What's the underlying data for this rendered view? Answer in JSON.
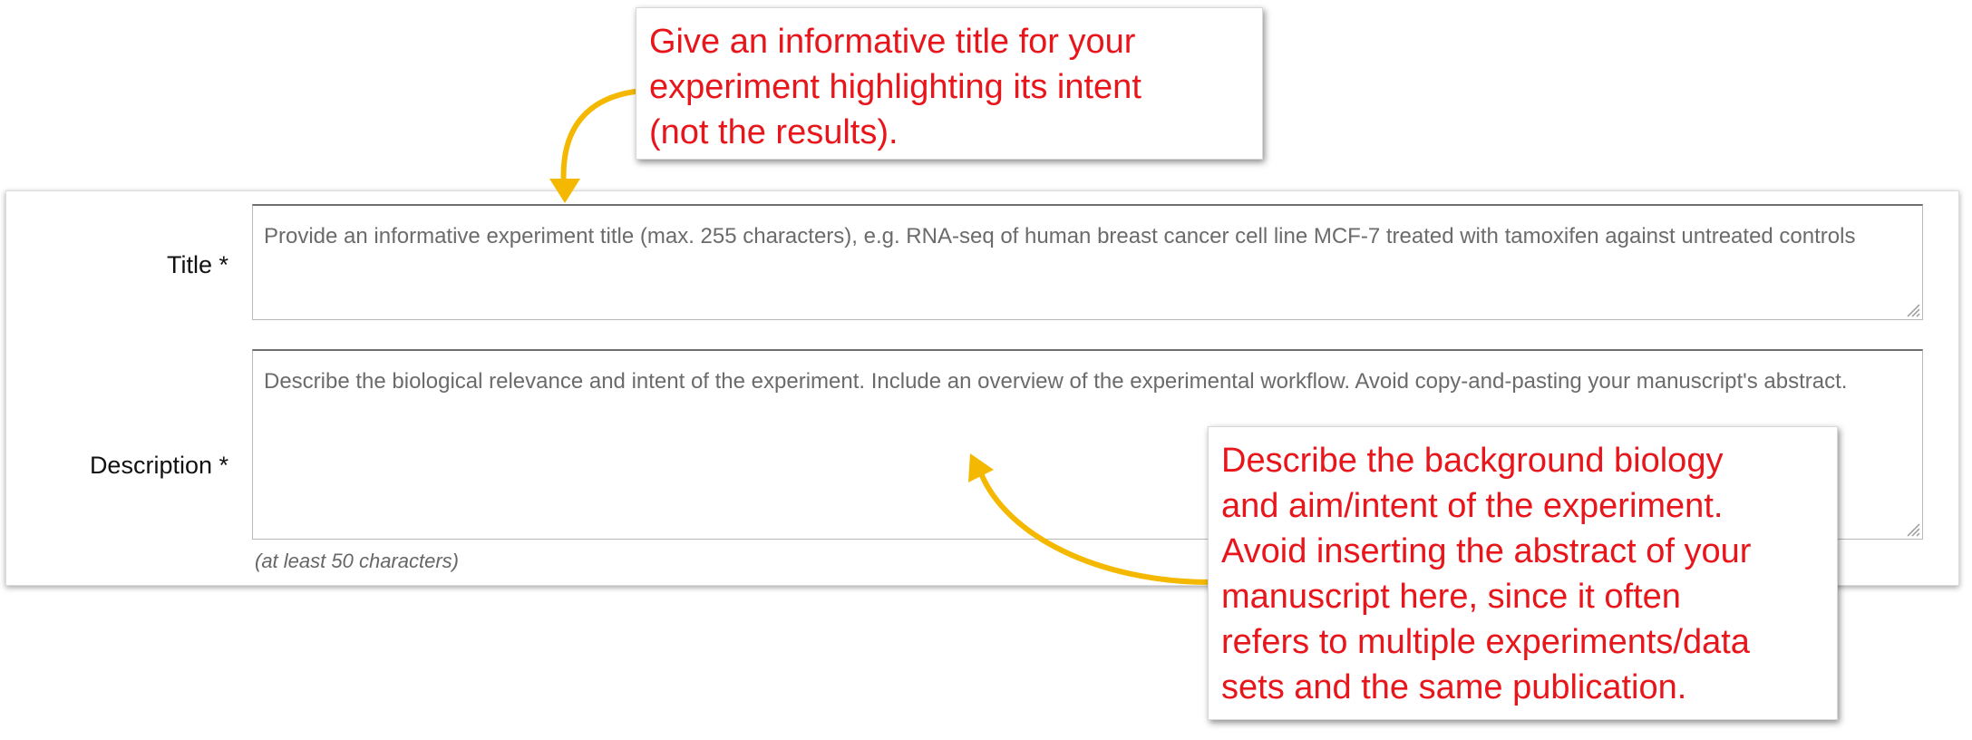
{
  "form": {
    "title_label": "Title *",
    "title_placeholder": "Provide an informative experiment title (max. 255 characters), e.g. RNA-seq of human breast cancer cell line MCF-7 treated with tamoxifen against untreated controls",
    "description_label": "Description *",
    "description_placeholder": "Describe the biological relevance and intent of the experiment. Include an overview of the experimental workflow. Avoid copy-and-pasting your manuscript's abstract.",
    "description_hint": "(at least 50 characters)"
  },
  "callouts": {
    "title_tip": {
      "lines": [
        "Give an informative title for your",
        "experiment highlighting its intent",
        "(not the results)."
      ]
    },
    "description_tip": {
      "lines": [
        "Describe the background biology",
        "and aim/intent of the experiment.",
        "Avoid inserting the abstract of your",
        "manuscript here, since it often",
        "refers to multiple experiments/data",
        "sets and the same publication."
      ]
    }
  },
  "colors": {
    "callout_text": "#e8151b",
    "arrow": "#f5b800"
  }
}
